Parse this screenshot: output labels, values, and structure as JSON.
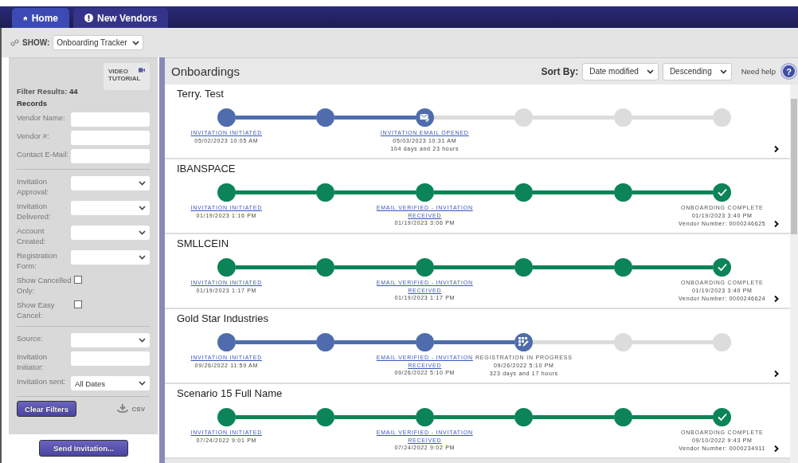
{
  "nav_tabs": [
    {
      "label": "Home",
      "selected": true
    },
    {
      "label": "New Vendors",
      "selected": false
    }
  ],
  "show_bar": {
    "label": "SHOW:",
    "value": "Onboarding Tracker"
  },
  "sidebar": {
    "video_tutorial": "VIDEO TUTORIAL",
    "filter_results": "Filter Results: **44 Records**",
    "filter_groups": [
      [
        {
          "kind": "text",
          "label": "Vendor Name:"
        },
        {
          "kind": "text",
          "label": "Vendor #:"
        },
        {
          "kind": "text",
          "label": "Contact E-Mail:"
        }
      ],
      [
        {
          "kind": "select",
          "label": "Invitation Approval:"
        },
        {
          "kind": "select",
          "label": "Invitation Delivered:"
        },
        {
          "kind": "select",
          "label": "Account Created:"
        },
        {
          "kind": "select",
          "label": "Registration Form:"
        },
        {
          "kind": "checkbox",
          "label": "Show Cancelled Only:",
          "checked": false
        },
        {
          "kind": "checkbox",
          "label": "Show Easy Cancel:",
          "checked": false
        }
      ],
      [
        {
          "kind": "select",
          "label": "Source:"
        },
        {
          "kind": "text",
          "label": "Invitation Initiator:"
        },
        {
          "kind": "select",
          "label": "Invitation sent:",
          "value": "All Dates"
        }
      ]
    ],
    "clear_button": "Clear Filters",
    "csv": "CSV",
    "send_button": "Send Invitation..."
  },
  "main": {
    "title": "Onboardings",
    "sort_label": "Sort By:",
    "sort_field": "Date modified",
    "sort_order": "Descending",
    "help": "Need help",
    "help_symbol": "?",
    "onboardings": [
      {
        "name": "Terry. Test",
        "color": "#4f6dad",
        "steps": [
          {
            "kind": "done",
            "label": {
              "title": "INVITATION INITIATED",
              "link": true,
              "details": [
                "05/02/2023 10:05 AM"
              ]
            }
          },
          {
            "kind": "done"
          },
          {
            "kind": "email",
            "label": {
              "title": "INVITATION EMAIL OPENED",
              "link": true,
              "details": [
                "05/03/2023 10:31 AM",
                "104 days and 23 hours"
              ]
            }
          },
          {
            "kind": "pending"
          },
          {
            "kind": "pending"
          },
          {
            "kind": "pending"
          }
        ]
      },
      {
        "name": "IBANSPACE",
        "color": "#0b8457",
        "steps": [
          {
            "kind": "done",
            "label": {
              "title": "INVITATION INITIATED",
              "link": true,
              "details": [
                "01/19/2023 1:16 PM"
              ]
            }
          },
          {
            "kind": "done"
          },
          {
            "kind": "done",
            "label": {
              "title": "EMAIL VERIFIED - INVITATION RECEIVED",
              "link": true,
              "details": [
                "01/19/2023 3:06 PM"
              ]
            }
          },
          {
            "kind": "done"
          },
          {
            "kind": "done"
          },
          {
            "kind": "check",
            "label": {
              "title": "ONBOARDING COMPLETE",
              "link": false,
              "details": [
                "01/19/2023 3:40 PM",
                "Vendor Number: 0000246625"
              ]
            }
          }
        ]
      },
      {
        "name": "SMLLCEIN",
        "color": "#0b8457",
        "steps": [
          {
            "kind": "done",
            "label": {
              "title": "INVITATION INITIATED",
              "link": true,
              "details": [
                "01/19/2023 1:17 PM"
              ]
            }
          },
          {
            "kind": "done"
          },
          {
            "kind": "done",
            "label": {
              "title": "EMAIL VERIFIED - INVITATION RECEIVED",
              "link": true,
              "details": [
                "01/19/2023 1:17 PM"
              ]
            }
          },
          {
            "kind": "done"
          },
          {
            "kind": "done"
          },
          {
            "kind": "check",
            "label": {
              "title": "ONBOARDING COMPLETE",
              "link": false,
              "details": [
                "01/19/2023 3:40 PM",
                "Vendor Number: 0000246624"
              ]
            }
          }
        ]
      },
      {
        "name": "Gold Star Industries",
        "color": "#4f6dad",
        "steps": [
          {
            "kind": "done",
            "label": {
              "title": "INVITATION INITIATED",
              "link": true,
              "details": [
                "09/26/2022 11:59 AM"
              ]
            }
          },
          {
            "kind": "done"
          },
          {
            "kind": "done",
            "label": {
              "title": "EMAIL VERIFIED - INVITATION RECEIVED",
              "link": true,
              "details": [
                "09/26/2022 5:10 PM"
              ]
            }
          },
          {
            "kind": "form",
            "label": {
              "title": "REGISTRATION IN PROGRESS",
              "link": false,
              "details": [
                "09/26/2022 5:10 PM",
                "323 days and 17 hours"
              ]
            }
          },
          {
            "kind": "pending"
          },
          {
            "kind": "pending"
          }
        ]
      },
      {
        "name": "Scenario 15 Full Name",
        "color": "#0b8457",
        "steps": [
          {
            "kind": "done",
            "label": {
              "title": "INVITATION INITIATED",
              "link": true,
              "details": [
                "07/24/2022 9:01 PM"
              ]
            }
          },
          {
            "kind": "done"
          },
          {
            "kind": "done",
            "label": {
              "title": "EMAIL VERIFIED - INVITATION RECEIVED",
              "link": true,
              "details": [
                "07/24/2022 9:02 PM"
              ]
            }
          },
          {
            "kind": "done"
          },
          {
            "kind": "done"
          },
          {
            "kind": "check",
            "label": {
              "title": "ONBOARDING COMPLETE",
              "link": false,
              "details": [
                "09/10/2022 9:43 PM",
                "Vendor Number: 0000234911"
              ]
            }
          }
        ]
      }
    ]
  }
}
